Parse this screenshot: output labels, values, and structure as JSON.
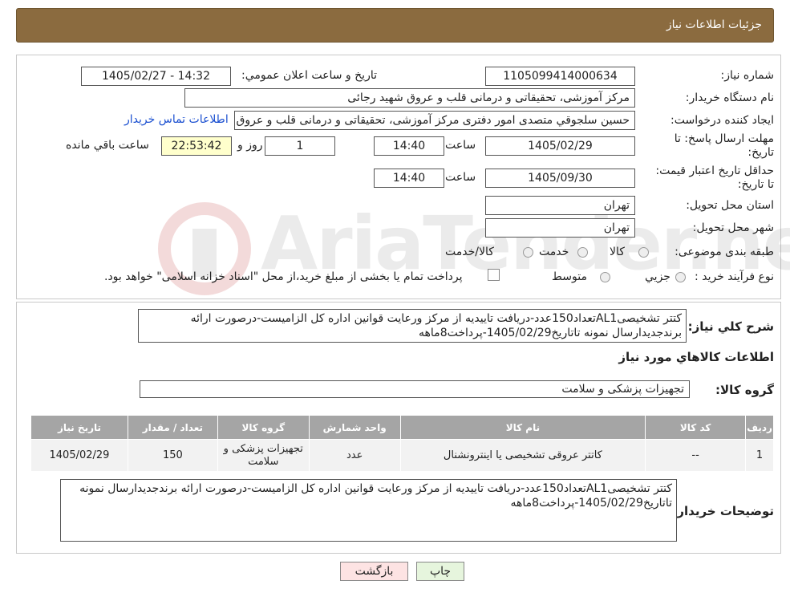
{
  "header": {
    "title": "جزئیات اطلاعات نیاز"
  },
  "labels": {
    "need_number": "شماره نیاز:",
    "announce_datetime": "تاریخ و ساعت اعلان عمومي:",
    "buyer_org": "نام دستگاه خريدار:",
    "requester": "ايجاد کننده درخواست:",
    "reply_deadline": "مهلت ارسال پاسخ: تا تاريخ:",
    "hour": "ساعت",
    "day_and": "روز و",
    "remaining": "ساعت باقي مانده",
    "validity_deadline": "حداقل تاريخ اعتبار قيمت: تا تاريخ:",
    "delivery_province": "استان محل تحويل:",
    "delivery_city": "شهر محل تحويل:",
    "category": "طبقه بندی موضوعی:",
    "purchase_type": "نوع فرآيند خريد :",
    "description": "شرح کلي نياز:",
    "goods_info": "اطلاعات كالاهاي مورد نياز",
    "goods_group": "گروه کالا:",
    "buyer_notes": "توضيحات خريدار:"
  },
  "values": {
    "need_number": "1105099414000634",
    "announce_datetime": "1405/02/27 - 14:32",
    "buyer_org": "مرکز آموزشی، تحقیقاتی و درمانی قلب و عروق شهید رجائی",
    "requester": "حسين سلجوقي متصدی امور دفتری مرکز آموزشی، تحقیقاتی و درمانی قلب و عروق شهید رجائی",
    "contact_link": "اطلاعات تماس خريدار",
    "reply_date": "1405/02/29",
    "reply_time": "14:40",
    "days": "1",
    "remaining_time": "22:53:42",
    "validity_date": "1405/09/30",
    "validity_time": "14:40",
    "province": "تهران",
    "city": "تهران",
    "goods_group": "تجهیزات پزشکی و سلامت"
  },
  "category_options": [
    "کالا",
    "خدمت",
    "کالا/خدمت"
  ],
  "purchase_options": [
    "جزيي",
    "متوسط"
  ],
  "purchase_note": "پرداخت تمام يا بخشی از مبلغ خريد،از محل \"اسناد خزانه اسلامی\" خواهد بود.",
  "description": "کتتر تشخیصیAL1تعداد150عدد-دریافت تاییدیه از مرکز ورعایت قوانین اداره کل الزامیست-درصورت ارائه برندجدیدارسال نمونه تاتاریخ1405/02/29-پرداخت8ماهه",
  "table": {
    "headers": [
      "رديف",
      "کد کالا",
      "نام کالا",
      "واحد شمارش",
      "گروه کالا",
      "تعداد / مقدار",
      "تاريخ نياز"
    ],
    "rows": [
      [
        "1",
        "--",
        "کاتتر عروقی تشخیصی یا اینترونشنال",
        "عدد",
        "تجهیزات پزشکی و سلامت",
        "150",
        "1405/02/29"
      ]
    ]
  },
  "buyer_notes": "کتتر تشخیصیAL1تعداد150عدد-دریافت تاییدیه از مرکز ورعایت قوانین اداره کل الزامیست-درصورت ارائه برندجدیدارسال نمونه تاتاریخ1405/02/29-پرداخت8ماهه",
  "buttons": {
    "print": "چاپ",
    "back": "بازگشت"
  },
  "watermark": {
    "text": "AriaTender.neT"
  },
  "colors": {
    "header": "#8b6b3f",
    "table_header": "#a5a5a5",
    "back_button": "#fde3e3",
    "print_button": "#e6f5dd",
    "link": "#1a4fd0"
  }
}
